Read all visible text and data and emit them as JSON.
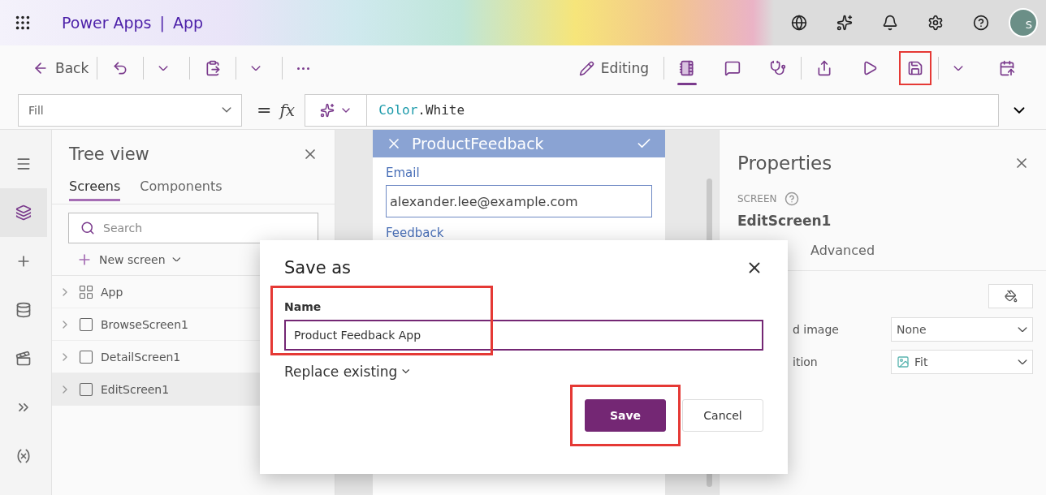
{
  "header": {
    "brand": "Power Apps",
    "separator": "|",
    "app": "App",
    "avatar_initial": "S"
  },
  "toolbar": {
    "back": "Back",
    "editing": "Editing",
    "tools": [
      {
        "selected": true,
        "highlighted": false
      },
      {
        "selected": false,
        "highlighted": false
      },
      {
        "selected": false,
        "highlighted": false
      },
      {
        "selected": false,
        "highlighted": false
      },
      {
        "selected": false,
        "highlighted": false
      },
      {
        "selected": false,
        "highlighted": true
      }
    ]
  },
  "formula_bar": {
    "property": "Fill",
    "equals": "=",
    "fx": "fx",
    "formula": [
      {
        "text": "Color",
        "kind": "identifier"
      },
      {
        "text": ".White",
        "kind": "member"
      }
    ]
  },
  "rail": [
    {
      "selected": false
    },
    {
      "selected": true
    },
    {
      "selected": false
    },
    {
      "selected": false
    },
    {
      "selected": false
    },
    {
      "selected": false
    }
  ],
  "tree_view": {
    "title": "Tree view",
    "tabs": [
      {
        "label": "Screens",
        "selected": true
      },
      {
        "label": "Components",
        "selected": false
      }
    ],
    "search": {
      "placeholder": "Search"
    },
    "new_screen": "New screen",
    "items": [
      {
        "label": "App",
        "kind": "app",
        "selected": false
      },
      {
        "label": "BrowseScreen1",
        "kind": "screen",
        "selected": false
      },
      {
        "label": "DetailScreen1",
        "kind": "screen",
        "selected": false
      },
      {
        "label": "EditScreen1",
        "kind": "screen",
        "selected": true
      }
    ]
  },
  "canvas": {
    "form_title": "ProductFeedback",
    "fields": [
      {
        "label": "Email",
        "value": "alexander.lee@example.com"
      },
      {
        "label": "Feedback"
      }
    ]
  },
  "properties": {
    "title": "Properties",
    "type": "SCREEN",
    "name": "EditScreen1",
    "tabs": [
      {
        "label": "Advanced",
        "selected": false
      }
    ],
    "rows": [
      {
        "label": "d image",
        "value": "None",
        "kind": "dropdown"
      },
      {
        "label": "ition",
        "value": "Fit",
        "kind": "image-dropdown"
      }
    ]
  },
  "dialog": {
    "title": "Save as",
    "name_label": "Name",
    "name_value": "Product Feedback App",
    "name_highlighted": true,
    "replace": "Replace existing",
    "buttons": [
      {
        "label": "Save",
        "kind": "primary",
        "highlighted": true
      },
      {
        "label": "Cancel",
        "kind": "secondary"
      }
    ]
  }
}
